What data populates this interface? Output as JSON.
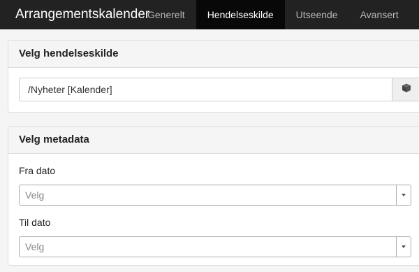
{
  "app": {
    "title": "Arrangementskalender"
  },
  "tabs": [
    {
      "label": "Generelt",
      "active": false
    },
    {
      "label": "Hendelseskilde",
      "active": true
    },
    {
      "label": "Utseende",
      "active": false
    },
    {
      "label": "Avansert",
      "active": false
    }
  ],
  "source_panel": {
    "heading": "Velg hendelseskilde",
    "path_value": "/Nyheter [Kalender]",
    "browse_icon": "cube-icon"
  },
  "metadata_panel": {
    "heading": "Velg metadata",
    "from_label": "Fra dato",
    "from_placeholder": "Velg",
    "to_label": "Til dato",
    "to_placeholder": "Velg"
  },
  "colors": {
    "navbar": "#222222",
    "active_tab": "#080808",
    "panel_heading": "#f5f5f5"
  }
}
